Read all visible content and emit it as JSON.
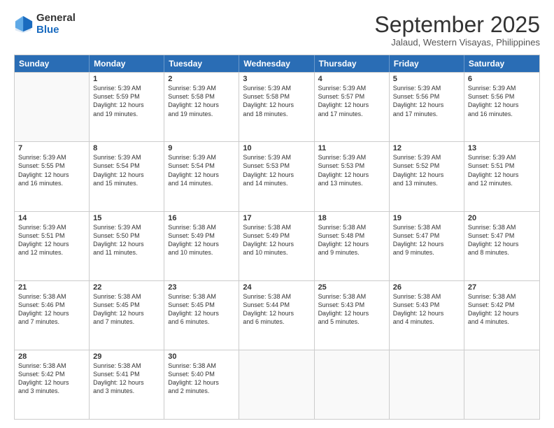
{
  "header": {
    "logo_general": "General",
    "logo_blue": "Blue",
    "month_title": "September 2025",
    "location": "Jalaud, Western Visayas, Philippines"
  },
  "calendar": {
    "days": [
      "Sunday",
      "Monday",
      "Tuesday",
      "Wednesday",
      "Thursday",
      "Friday",
      "Saturday"
    ],
    "weeks": [
      [
        {
          "day": "",
          "empty": true
        },
        {
          "day": "1",
          "line1": "Sunrise: 5:39 AM",
          "line2": "Sunset: 5:59 PM",
          "line3": "Daylight: 12 hours",
          "line4": "and 19 minutes."
        },
        {
          "day": "2",
          "line1": "Sunrise: 5:39 AM",
          "line2": "Sunset: 5:58 PM",
          "line3": "Daylight: 12 hours",
          "line4": "and 19 minutes."
        },
        {
          "day": "3",
          "line1": "Sunrise: 5:39 AM",
          "line2": "Sunset: 5:58 PM",
          "line3": "Daylight: 12 hours",
          "line4": "and 18 minutes."
        },
        {
          "day": "4",
          "line1": "Sunrise: 5:39 AM",
          "line2": "Sunset: 5:57 PM",
          "line3": "Daylight: 12 hours",
          "line4": "and 17 minutes."
        },
        {
          "day": "5",
          "line1": "Sunrise: 5:39 AM",
          "line2": "Sunset: 5:56 PM",
          "line3": "Daylight: 12 hours",
          "line4": "and 17 minutes."
        },
        {
          "day": "6",
          "line1": "Sunrise: 5:39 AM",
          "line2": "Sunset: 5:56 PM",
          "line3": "Daylight: 12 hours",
          "line4": "and 16 minutes."
        }
      ],
      [
        {
          "day": "7",
          "line1": "Sunrise: 5:39 AM",
          "line2": "Sunset: 5:55 PM",
          "line3": "Daylight: 12 hours",
          "line4": "and 16 minutes."
        },
        {
          "day": "8",
          "line1": "Sunrise: 5:39 AM",
          "line2": "Sunset: 5:54 PM",
          "line3": "Daylight: 12 hours",
          "line4": "and 15 minutes."
        },
        {
          "day": "9",
          "line1": "Sunrise: 5:39 AM",
          "line2": "Sunset: 5:54 PM",
          "line3": "Daylight: 12 hours",
          "line4": "and 14 minutes."
        },
        {
          "day": "10",
          "line1": "Sunrise: 5:39 AM",
          "line2": "Sunset: 5:53 PM",
          "line3": "Daylight: 12 hours",
          "line4": "and 14 minutes."
        },
        {
          "day": "11",
          "line1": "Sunrise: 5:39 AM",
          "line2": "Sunset: 5:53 PM",
          "line3": "Daylight: 12 hours",
          "line4": "and 13 minutes."
        },
        {
          "day": "12",
          "line1": "Sunrise: 5:39 AM",
          "line2": "Sunset: 5:52 PM",
          "line3": "Daylight: 12 hours",
          "line4": "and 13 minutes."
        },
        {
          "day": "13",
          "line1": "Sunrise: 5:39 AM",
          "line2": "Sunset: 5:51 PM",
          "line3": "Daylight: 12 hours",
          "line4": "and 12 minutes."
        }
      ],
      [
        {
          "day": "14",
          "line1": "Sunrise: 5:39 AM",
          "line2": "Sunset: 5:51 PM",
          "line3": "Daylight: 12 hours",
          "line4": "and 12 minutes."
        },
        {
          "day": "15",
          "line1": "Sunrise: 5:39 AM",
          "line2": "Sunset: 5:50 PM",
          "line3": "Daylight: 12 hours",
          "line4": "and 11 minutes."
        },
        {
          "day": "16",
          "line1": "Sunrise: 5:38 AM",
          "line2": "Sunset: 5:49 PM",
          "line3": "Daylight: 12 hours",
          "line4": "and 10 minutes."
        },
        {
          "day": "17",
          "line1": "Sunrise: 5:38 AM",
          "line2": "Sunset: 5:49 PM",
          "line3": "Daylight: 12 hours",
          "line4": "and 10 minutes."
        },
        {
          "day": "18",
          "line1": "Sunrise: 5:38 AM",
          "line2": "Sunset: 5:48 PM",
          "line3": "Daylight: 12 hours",
          "line4": "and 9 minutes."
        },
        {
          "day": "19",
          "line1": "Sunrise: 5:38 AM",
          "line2": "Sunset: 5:47 PM",
          "line3": "Daylight: 12 hours",
          "line4": "and 9 minutes."
        },
        {
          "day": "20",
          "line1": "Sunrise: 5:38 AM",
          "line2": "Sunset: 5:47 PM",
          "line3": "Daylight: 12 hours",
          "line4": "and 8 minutes."
        }
      ],
      [
        {
          "day": "21",
          "line1": "Sunrise: 5:38 AM",
          "line2": "Sunset: 5:46 PM",
          "line3": "Daylight: 12 hours",
          "line4": "and 7 minutes."
        },
        {
          "day": "22",
          "line1": "Sunrise: 5:38 AM",
          "line2": "Sunset: 5:45 PM",
          "line3": "Daylight: 12 hours",
          "line4": "and 7 minutes."
        },
        {
          "day": "23",
          "line1": "Sunrise: 5:38 AM",
          "line2": "Sunset: 5:45 PM",
          "line3": "Daylight: 12 hours",
          "line4": "and 6 minutes."
        },
        {
          "day": "24",
          "line1": "Sunrise: 5:38 AM",
          "line2": "Sunset: 5:44 PM",
          "line3": "Daylight: 12 hours",
          "line4": "and 6 minutes."
        },
        {
          "day": "25",
          "line1": "Sunrise: 5:38 AM",
          "line2": "Sunset: 5:43 PM",
          "line3": "Daylight: 12 hours",
          "line4": "and 5 minutes."
        },
        {
          "day": "26",
          "line1": "Sunrise: 5:38 AM",
          "line2": "Sunset: 5:43 PM",
          "line3": "Daylight: 12 hours",
          "line4": "and 4 minutes."
        },
        {
          "day": "27",
          "line1": "Sunrise: 5:38 AM",
          "line2": "Sunset: 5:42 PM",
          "line3": "Daylight: 12 hours",
          "line4": "and 4 minutes."
        }
      ],
      [
        {
          "day": "28",
          "line1": "Sunrise: 5:38 AM",
          "line2": "Sunset: 5:42 PM",
          "line3": "Daylight: 12 hours",
          "line4": "and 3 minutes."
        },
        {
          "day": "29",
          "line1": "Sunrise: 5:38 AM",
          "line2": "Sunset: 5:41 PM",
          "line3": "Daylight: 12 hours",
          "line4": "and 3 minutes."
        },
        {
          "day": "30",
          "line1": "Sunrise: 5:38 AM",
          "line2": "Sunset: 5:40 PM",
          "line3": "Daylight: 12 hours",
          "line4": "and 2 minutes."
        },
        {
          "day": "",
          "empty": true
        },
        {
          "day": "",
          "empty": true
        },
        {
          "day": "",
          "empty": true
        },
        {
          "day": "",
          "empty": true
        }
      ]
    ]
  }
}
